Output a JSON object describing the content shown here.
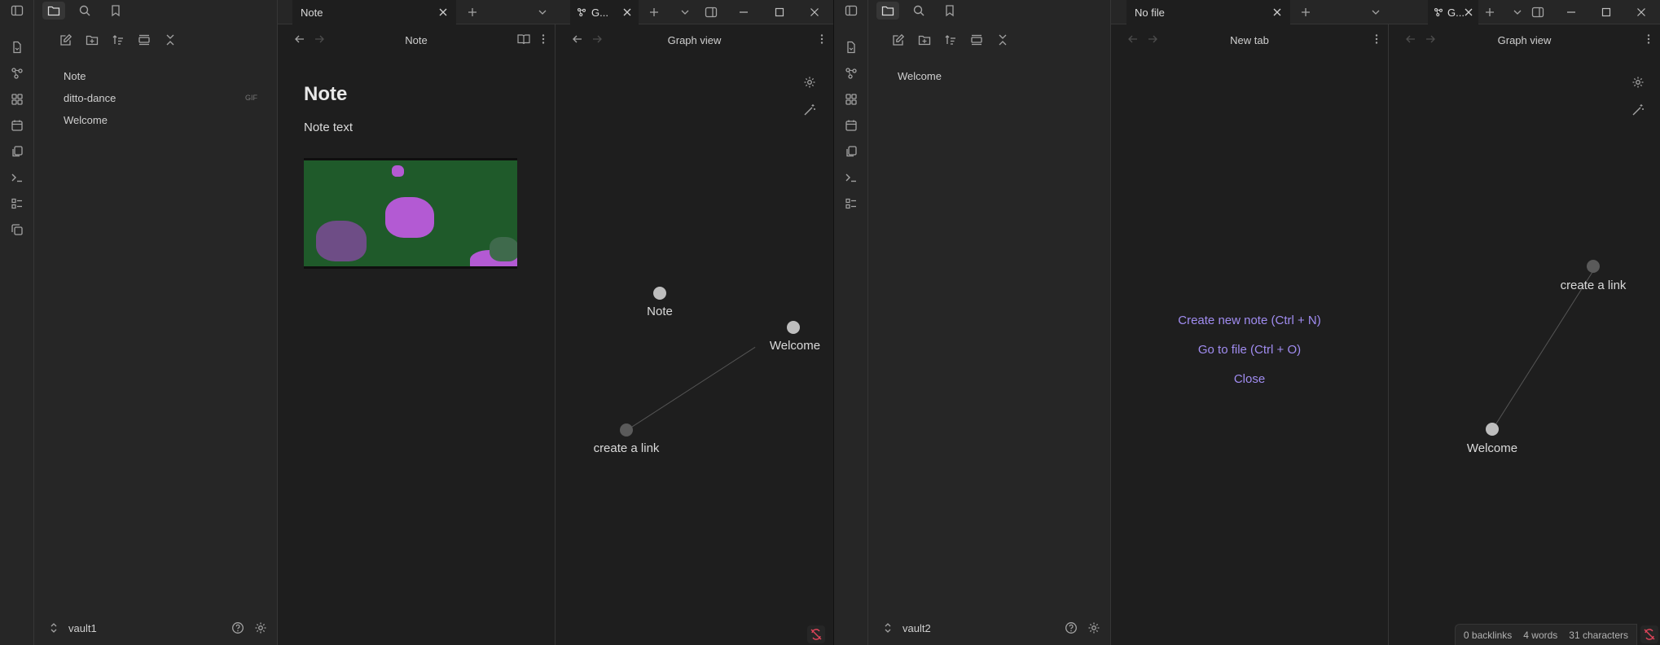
{
  "window1": {
    "sidebar": {
      "files": [
        {
          "name": "Note",
          "tag": ""
        },
        {
          "name": "ditto-dance",
          "tag": "GIF"
        },
        {
          "name": "Welcome",
          "tag": ""
        }
      ],
      "vault": "vault1"
    },
    "tabs": {
      "note_tab": "Note",
      "graph_tab": "G..."
    },
    "note_pane": {
      "header_title": "Note",
      "heading": "Note",
      "body": "Note text"
    },
    "graph_pane": {
      "header_title": "Graph view",
      "nodes": [
        "Note",
        "Welcome",
        "create a link"
      ]
    }
  },
  "window2": {
    "sidebar": {
      "files": [
        {
          "name": "Welcome"
        }
      ],
      "vault": "vault2"
    },
    "tabs": {
      "nofile_tab": "No file",
      "graph_tab": "G..."
    },
    "newtab_pane": {
      "header_title": "New tab",
      "actions": [
        "Create new note (Ctrl + N)",
        "Go to file (Ctrl + O)",
        "Close"
      ]
    },
    "graph_pane": {
      "header_title": "Graph view",
      "nodes": [
        "create a link",
        "Welcome"
      ]
    },
    "status": {
      "backlinks": "0 backlinks",
      "words": "4 words",
      "characters": "31 characters"
    }
  },
  "colors": {
    "background": "#1e1e1e",
    "panel": "#262626",
    "accent": "#a08cf0",
    "sync_error": "#e0455a"
  }
}
